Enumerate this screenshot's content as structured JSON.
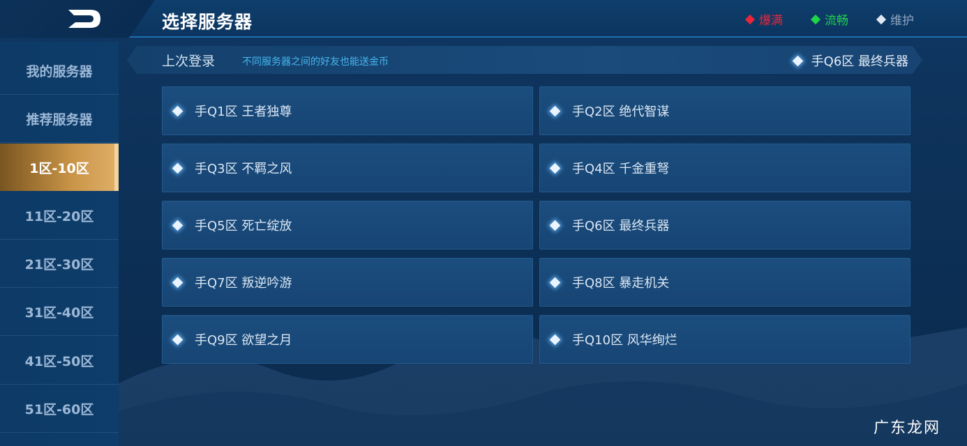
{
  "header": {
    "title": "选择服务器",
    "legend": [
      {
        "label": "爆满",
        "color": "#e8263a"
      },
      {
        "label": "流畅",
        "color": "#1fd64a"
      },
      {
        "label": "维护",
        "color": "#8fa6bf"
      }
    ]
  },
  "sidebar": {
    "items": [
      {
        "label": "我的服务器"
      },
      {
        "label": "推荐服务器"
      },
      {
        "label": "1区-10区"
      },
      {
        "label": "11区-20区"
      },
      {
        "label": "21区-30区"
      },
      {
        "label": "31区-40区"
      },
      {
        "label": "41区-50区"
      },
      {
        "label": "51区-60区"
      }
    ],
    "active_index": 2
  },
  "last_login": {
    "label": "上次登录",
    "hint": "不同服务器之间的好友也能送金币",
    "server": "手Q6区 最终兵器"
  },
  "servers": [
    {
      "name": "手Q1区 王者独尊"
    },
    {
      "name": "手Q2区 绝代智谋"
    },
    {
      "name": "手Q3区 不羁之风"
    },
    {
      "name": "手Q4区 千金重弩"
    },
    {
      "name": "手Q5区 死亡绽放"
    },
    {
      "name": "手Q6区 最终兵器"
    },
    {
      "name": "手Q7区 叛逆吟游"
    },
    {
      "name": "手Q8区 暴走机关"
    },
    {
      "name": "手Q9区 欲望之月"
    },
    {
      "name": "手Q10区 风华绚烂"
    }
  ],
  "watermark": "广东龙网",
  "colors": {
    "accent_gold": "#c89447",
    "hint_blue": "#46b6ef"
  }
}
